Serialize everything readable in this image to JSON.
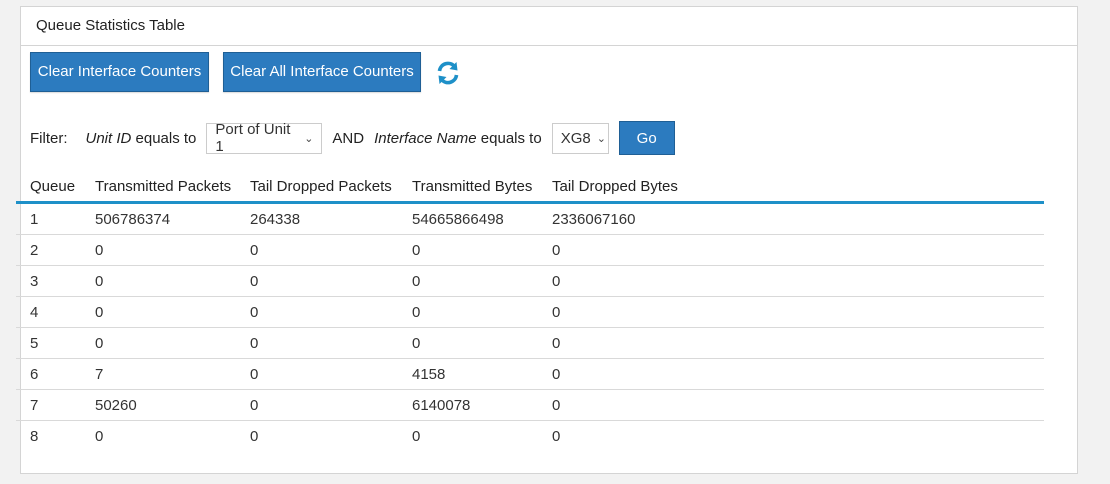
{
  "panel": {
    "title": "Queue Statistics Table"
  },
  "buttons": {
    "clear_interface": "Clear Interface Counters",
    "clear_all": "Clear All Interface Counters",
    "go": "Go"
  },
  "filter": {
    "label": "Filter:",
    "unit_field": "Unit ID",
    "equals_to": "equals to",
    "unit_value": "Port of Unit 1",
    "and": "AND",
    "iface_field": "Interface Name",
    "iface_value": "XG8"
  },
  "table": {
    "headers": [
      "Queue",
      "Transmitted Packets",
      "Tail Dropped Packets",
      "Transmitted Bytes",
      "Tail Dropped Bytes"
    ],
    "rows": [
      [
        "1",
        "506786374",
        "264338",
        "54665866498",
        "2336067160"
      ],
      [
        "2",
        "0",
        "0",
        "0",
        "0"
      ],
      [
        "3",
        "0",
        "0",
        "0",
        "0"
      ],
      [
        "4",
        "0",
        "0",
        "0",
        "0"
      ],
      [
        "5",
        "0",
        "0",
        "0",
        "0"
      ],
      [
        "6",
        "7",
        "0",
        "4158",
        "0"
      ],
      [
        "7",
        "50260",
        "0",
        "6140078",
        "0"
      ],
      [
        "8",
        "0",
        "0",
        "0",
        "0"
      ]
    ]
  },
  "icons": {
    "refresh": "refresh-icon",
    "dropdown": "chevron-down-icon"
  },
  "colors": {
    "accent": "#2c7bbf",
    "header_rule": "#1e90c8"
  }
}
